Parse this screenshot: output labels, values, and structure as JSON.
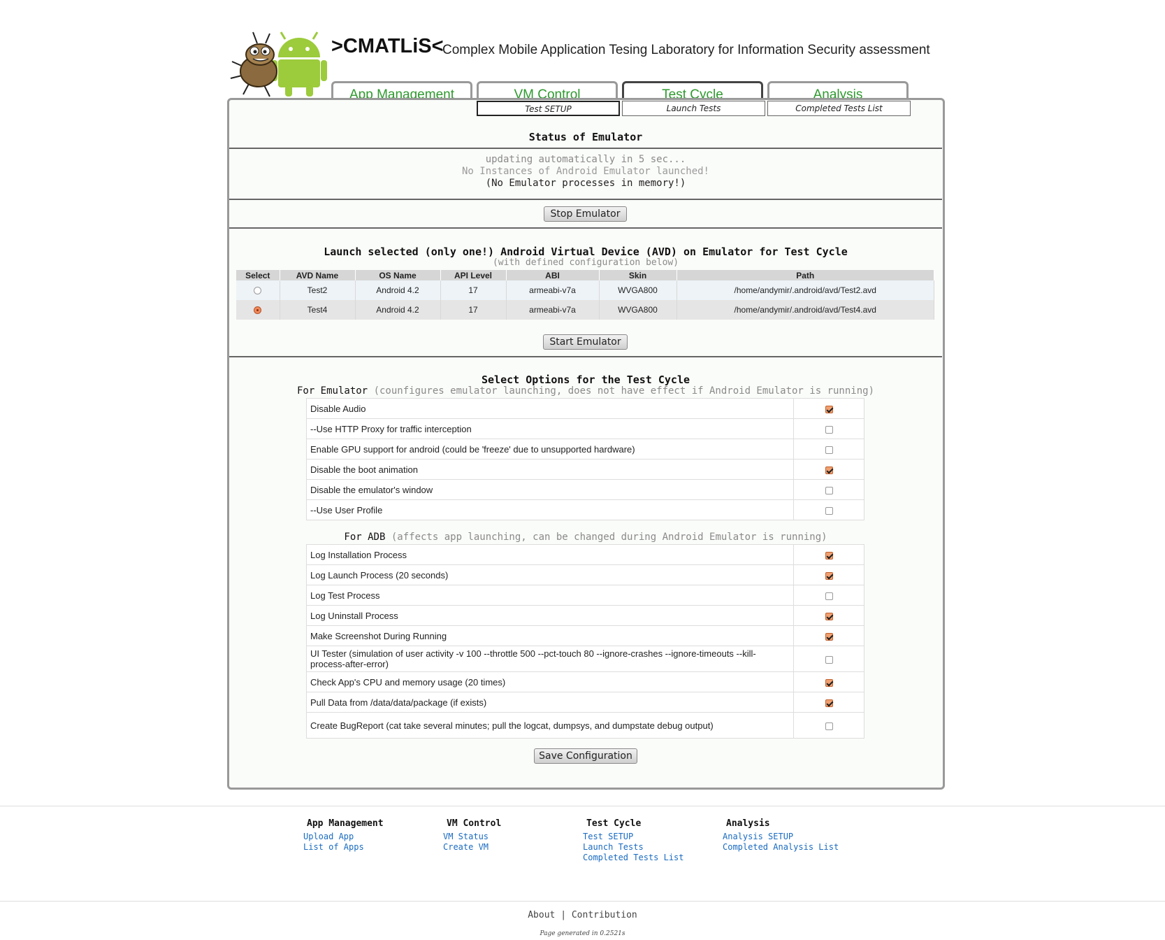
{
  "header": {
    "brand": ">CMATLiS<",
    "subtitle": "Complex Mobile Application Tesing Laboratory for Information Security assessment",
    "logo_icon": "bug-and-android-robot-logo"
  },
  "main_tabs": [
    {
      "label": "App Management",
      "active": false
    },
    {
      "label": "VM Control",
      "active": false
    },
    {
      "label": "Test Cycle",
      "active": true
    },
    {
      "label": "Analysis",
      "active": false
    }
  ],
  "sub_tabs": [
    {
      "label": "Test SETUP",
      "active": true
    },
    {
      "label": "Launch Tests",
      "active": false
    },
    {
      "label": "Completed Tests List",
      "active": false
    }
  ],
  "status": {
    "title": "Status of Emulator",
    "updating": "updating automatically in 5 sec...",
    "no_instances": "No Instances of Android Emulator launched!",
    "no_processes": "(No Emulator processes in memory!)",
    "stop_button": "Stop Emulator"
  },
  "launch": {
    "title": "Launch selected (only one!) Android Virtual Device (AVD) on Emulator for Test Cycle",
    "subtitle": "(with defined configuration below)",
    "columns": [
      "Select",
      "AVD Name",
      "OS Name",
      "API Level",
      "ABI",
      "Skin",
      "Path"
    ],
    "rows": [
      {
        "selected": false,
        "name": "Test2",
        "os": "Android 4.2",
        "api": "17",
        "abi": "armeabi-v7a",
        "skin": "WVGA800",
        "path": "/home/andymir/.android/avd/Test2.avd"
      },
      {
        "selected": true,
        "name": "Test4",
        "os": "Android 4.2",
        "api": "17",
        "abi": "armeabi-v7a",
        "skin": "WVGA800",
        "path": "/home/andymir/.android/avd/Test4.avd"
      }
    ],
    "start_button": "Start Emulator"
  },
  "options": {
    "title": "Select Options for the Test Cycle",
    "emulator_head": "For Emulator",
    "emulator_note": "(counfigures emulator launching, does not have effect if Android Emulator is running)",
    "emulator_options": [
      {
        "label": "Disable Audio",
        "checked": true
      },
      {
        "label": "--Use HTTP Proxy for traffic interception",
        "checked": false
      },
      {
        "label": "Enable GPU support for android (could be 'freeze' due to unsupported hardware)",
        "checked": false
      },
      {
        "label": "Disable the boot animation",
        "checked": true
      },
      {
        "label": "Disable the emulator's window",
        "checked": false
      },
      {
        "label": "--Use User Profile",
        "checked": false
      }
    ],
    "adb_head": "For ADB",
    "adb_note": "(affects app launching, can be changed during Android Emulator is running)",
    "adb_options": [
      {
        "label": "Log Installation Process",
        "checked": true
      },
      {
        "label": "Log Launch Process (20 seconds)",
        "checked": true
      },
      {
        "label": "Log Test Process",
        "checked": false
      },
      {
        "label": "Log Uninstall Process",
        "checked": true
      },
      {
        "label": "Make Screenshot During Running",
        "checked": true
      },
      {
        "label": "UI Tester (simulation of user activity -v 100 --throttle 500 --pct-touch 80 --ignore-crashes --ignore-timeouts --kill-process-after-error)",
        "checked": false
      },
      {
        "label": "Check App's CPU and memory usage (20 times)",
        "checked": true
      },
      {
        "label": "Pull Data from /data/data/package (if exists)",
        "checked": true
      },
      {
        "label": "Create BugReport (cat take several minutes; pull the logcat, dumpsys, and dumpstate debug output)",
        "checked": false
      }
    ],
    "save_button": "Save Configuration"
  },
  "footer": {
    "columns": [
      {
        "heading": "App Management",
        "links": [
          "Upload App",
          "List of Apps"
        ]
      },
      {
        "heading": "VM Control",
        "links": [
          "VM Status",
          "Create VM"
        ]
      },
      {
        "heading": "Test Cycle",
        "links": [
          "Test SETUP",
          "Launch Tests",
          "Completed Tests List"
        ]
      },
      {
        "heading": "Analysis",
        "links": [
          "Analysis SETUP",
          "Completed Analysis List"
        ]
      }
    ],
    "about": "About",
    "divider": "|",
    "contribution": "Contribution",
    "generated": "Page generated in 0.2521s"
  }
}
